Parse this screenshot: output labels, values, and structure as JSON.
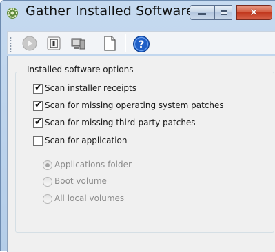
{
  "window": {
    "title": "Gather Installed Software",
    "app_icon": "gear-icon",
    "minimize_icon": "minimize-icon",
    "maximize_icon": "maximize-icon",
    "close_icon": "close-icon",
    "close_glyph": "✕"
  },
  "toolbar": {
    "buttons": [
      {
        "icon": "play-icon",
        "enabled": false
      },
      {
        "icon": "stop-icon",
        "enabled": true
      },
      {
        "icon": "computer-icon",
        "enabled": true
      },
      {
        "icon": "document-icon",
        "enabled": true
      },
      {
        "icon": "help-icon",
        "enabled": true
      }
    ]
  },
  "group": {
    "title": "Installed software options",
    "options": [
      {
        "label": "Scan installer receipts",
        "checked": true
      },
      {
        "label": "Scan for missing operating system patches",
        "checked": true
      },
      {
        "label": "Scan for missing third-party patches",
        "checked": true
      },
      {
        "label": "Scan for application",
        "checked": false
      }
    ],
    "radios": [
      {
        "label": "Applications folder",
        "selected": true,
        "enabled": false
      },
      {
        "label": "Boot volume",
        "selected": false,
        "enabled": false
      },
      {
        "label": "All local volumes",
        "selected": false,
        "enabled": false
      }
    ],
    "check_glyph": "✔"
  },
  "colors": {
    "title_bar": "#c6daf0",
    "close_button": "#c1371d",
    "help_blue": "#1f5fc7"
  }
}
